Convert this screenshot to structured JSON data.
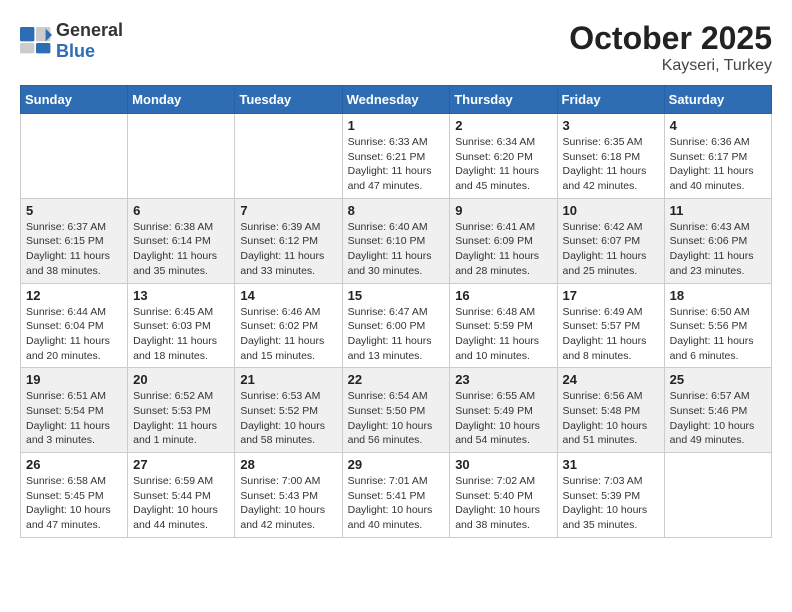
{
  "header": {
    "logo_general": "General",
    "logo_blue": "Blue",
    "month": "October 2025",
    "location": "Kayseri, Turkey"
  },
  "weekdays": [
    "Sunday",
    "Monday",
    "Tuesday",
    "Wednesday",
    "Thursday",
    "Friday",
    "Saturday"
  ],
  "rows": [
    [
      {
        "day": "",
        "info": ""
      },
      {
        "day": "",
        "info": ""
      },
      {
        "day": "",
        "info": ""
      },
      {
        "day": "1",
        "info": "Sunrise: 6:33 AM\nSunset: 6:21 PM\nDaylight: 11 hours\nand 47 minutes."
      },
      {
        "day": "2",
        "info": "Sunrise: 6:34 AM\nSunset: 6:20 PM\nDaylight: 11 hours\nand 45 minutes."
      },
      {
        "day": "3",
        "info": "Sunrise: 6:35 AM\nSunset: 6:18 PM\nDaylight: 11 hours\nand 42 minutes."
      },
      {
        "day": "4",
        "info": "Sunrise: 6:36 AM\nSunset: 6:17 PM\nDaylight: 11 hours\nand 40 minutes."
      }
    ],
    [
      {
        "day": "5",
        "info": "Sunrise: 6:37 AM\nSunset: 6:15 PM\nDaylight: 11 hours\nand 38 minutes."
      },
      {
        "day": "6",
        "info": "Sunrise: 6:38 AM\nSunset: 6:14 PM\nDaylight: 11 hours\nand 35 minutes."
      },
      {
        "day": "7",
        "info": "Sunrise: 6:39 AM\nSunset: 6:12 PM\nDaylight: 11 hours\nand 33 minutes."
      },
      {
        "day": "8",
        "info": "Sunrise: 6:40 AM\nSunset: 6:10 PM\nDaylight: 11 hours\nand 30 minutes."
      },
      {
        "day": "9",
        "info": "Sunrise: 6:41 AM\nSunset: 6:09 PM\nDaylight: 11 hours\nand 28 minutes."
      },
      {
        "day": "10",
        "info": "Sunrise: 6:42 AM\nSunset: 6:07 PM\nDaylight: 11 hours\nand 25 minutes."
      },
      {
        "day": "11",
        "info": "Sunrise: 6:43 AM\nSunset: 6:06 PM\nDaylight: 11 hours\nand 23 minutes."
      }
    ],
    [
      {
        "day": "12",
        "info": "Sunrise: 6:44 AM\nSunset: 6:04 PM\nDaylight: 11 hours\nand 20 minutes."
      },
      {
        "day": "13",
        "info": "Sunrise: 6:45 AM\nSunset: 6:03 PM\nDaylight: 11 hours\nand 18 minutes."
      },
      {
        "day": "14",
        "info": "Sunrise: 6:46 AM\nSunset: 6:02 PM\nDaylight: 11 hours\nand 15 minutes."
      },
      {
        "day": "15",
        "info": "Sunrise: 6:47 AM\nSunset: 6:00 PM\nDaylight: 11 hours\nand 13 minutes."
      },
      {
        "day": "16",
        "info": "Sunrise: 6:48 AM\nSunset: 5:59 PM\nDaylight: 11 hours\nand 10 minutes."
      },
      {
        "day": "17",
        "info": "Sunrise: 6:49 AM\nSunset: 5:57 PM\nDaylight: 11 hours\nand 8 minutes."
      },
      {
        "day": "18",
        "info": "Sunrise: 6:50 AM\nSunset: 5:56 PM\nDaylight: 11 hours\nand 6 minutes."
      }
    ],
    [
      {
        "day": "19",
        "info": "Sunrise: 6:51 AM\nSunset: 5:54 PM\nDaylight: 11 hours\nand 3 minutes."
      },
      {
        "day": "20",
        "info": "Sunrise: 6:52 AM\nSunset: 5:53 PM\nDaylight: 11 hours\nand 1 minute."
      },
      {
        "day": "21",
        "info": "Sunrise: 6:53 AM\nSunset: 5:52 PM\nDaylight: 10 hours\nand 58 minutes."
      },
      {
        "day": "22",
        "info": "Sunrise: 6:54 AM\nSunset: 5:50 PM\nDaylight: 10 hours\nand 56 minutes."
      },
      {
        "day": "23",
        "info": "Sunrise: 6:55 AM\nSunset: 5:49 PM\nDaylight: 10 hours\nand 54 minutes."
      },
      {
        "day": "24",
        "info": "Sunrise: 6:56 AM\nSunset: 5:48 PM\nDaylight: 10 hours\nand 51 minutes."
      },
      {
        "day": "25",
        "info": "Sunrise: 6:57 AM\nSunset: 5:46 PM\nDaylight: 10 hours\nand 49 minutes."
      }
    ],
    [
      {
        "day": "26",
        "info": "Sunrise: 6:58 AM\nSunset: 5:45 PM\nDaylight: 10 hours\nand 47 minutes."
      },
      {
        "day": "27",
        "info": "Sunrise: 6:59 AM\nSunset: 5:44 PM\nDaylight: 10 hours\nand 44 minutes."
      },
      {
        "day": "28",
        "info": "Sunrise: 7:00 AM\nSunset: 5:43 PM\nDaylight: 10 hours\nand 42 minutes."
      },
      {
        "day": "29",
        "info": "Sunrise: 7:01 AM\nSunset: 5:41 PM\nDaylight: 10 hours\nand 40 minutes."
      },
      {
        "day": "30",
        "info": "Sunrise: 7:02 AM\nSunset: 5:40 PM\nDaylight: 10 hours\nand 38 minutes."
      },
      {
        "day": "31",
        "info": "Sunrise: 7:03 AM\nSunset: 5:39 PM\nDaylight: 10 hours\nand 35 minutes."
      },
      {
        "day": "",
        "info": ""
      }
    ]
  ]
}
